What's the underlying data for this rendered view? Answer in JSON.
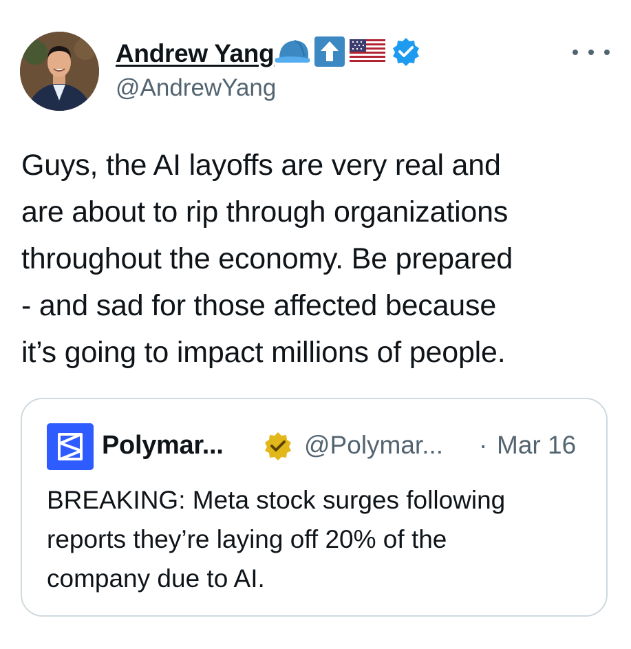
{
  "author": {
    "display_name": "Andrew Yang",
    "handle": "@AndrewYang",
    "name_emojis": [
      "blue-cap-emoji",
      "up-arrow-emoji",
      "us-flag-emoji"
    ],
    "verified": true,
    "verified_color": "#1d9bf0"
  },
  "tweet": {
    "text": "Guys, the AI layoffs are very real and\nare about to rip through organizations\nthroughout the economy.  Be prepared\n- and sad for those affected because\nit’s going to impact millions of people."
  },
  "quoted_tweet": {
    "display_name": "Polymar...",
    "handle": "@Polymar...",
    "separator": "·",
    "date": "Mar 16",
    "verified_badge": "gold-verified-icon",
    "brand_color": "#2e5cff",
    "text": "BREAKING: Meta stock surges following\nreports they’re laying off 20% of the\ncompany due to AI."
  },
  "icons": {
    "more": "more-options-icon"
  }
}
